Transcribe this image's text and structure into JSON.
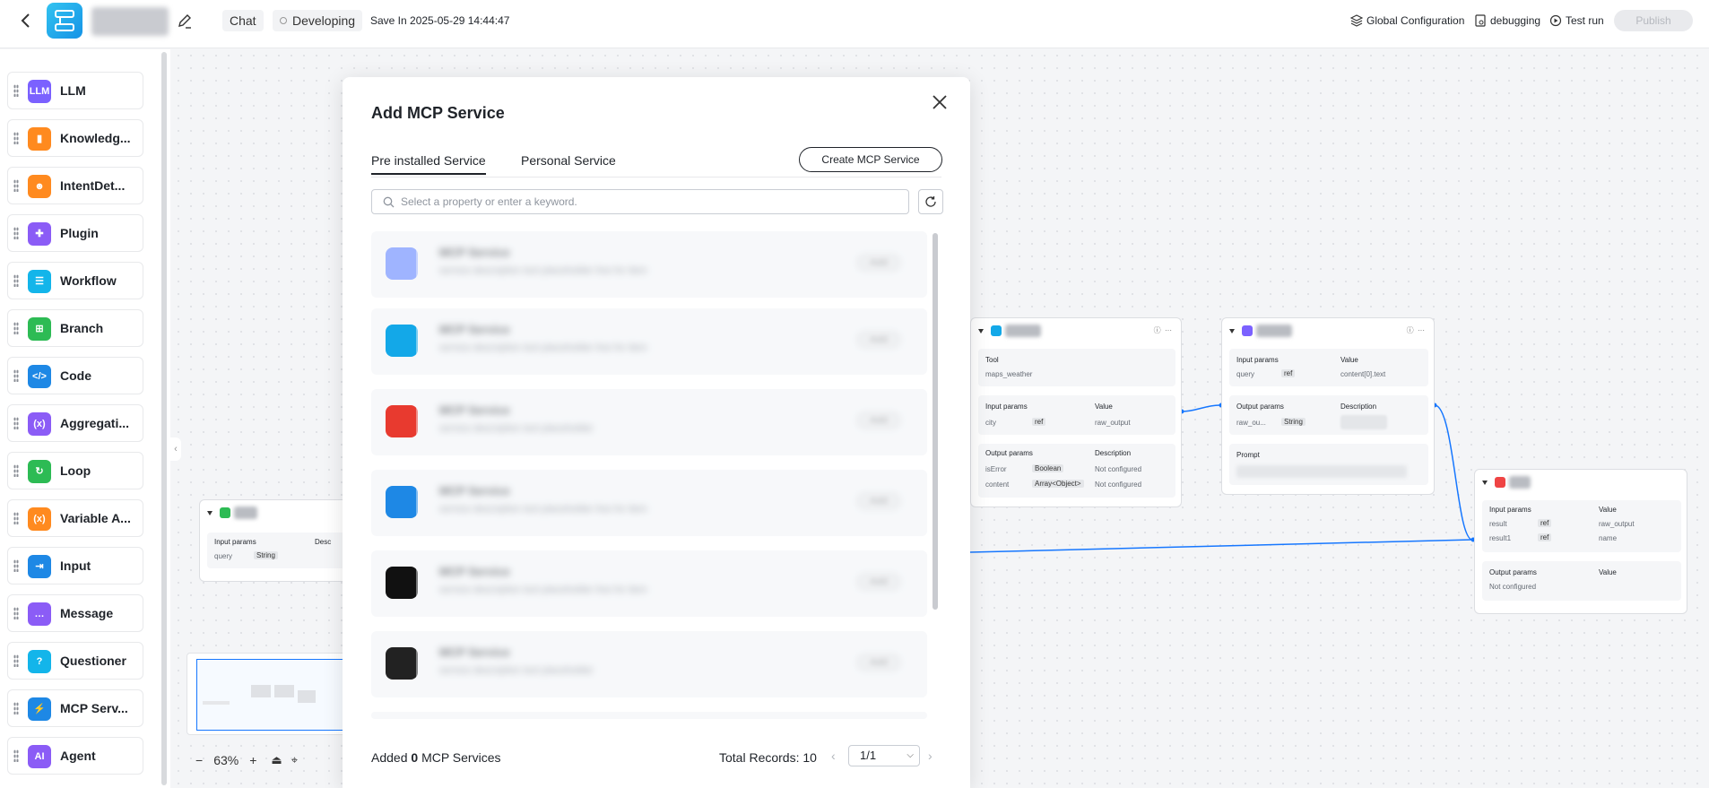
{
  "header": {
    "chat_label": "Chat",
    "status_label": "Developing",
    "save_text": "Save In 2025-05-29 14:44:47",
    "global_config_label": "Global Configuration",
    "debugging_label": "debugging",
    "test_run_label": "Test run",
    "publish_label": "Publish"
  },
  "sidebar": {
    "items": [
      {
        "label": "LLM",
        "icon": "llm-icon",
        "icon_text": "LLM",
        "color": "#7b61ff"
      },
      {
        "label": "Knowledg...",
        "icon": "book-icon",
        "icon_text": "▮",
        "color": "#ff8a1f"
      },
      {
        "label": "IntentDet...",
        "icon": "intent-icon",
        "icon_text": "☻",
        "color": "#ff8a1f"
      },
      {
        "label": "Plugin",
        "icon": "puzzle-icon",
        "icon_text": "✚",
        "color": "#8b5cf6"
      },
      {
        "label": "Workflow",
        "icon": "workflow-icon",
        "icon_text": "☰",
        "color": "#13b5ea"
      },
      {
        "label": "Branch",
        "icon": "branch-icon",
        "icon_text": "⊞",
        "color": "#2dbb54"
      },
      {
        "label": "Code",
        "icon": "code-icon",
        "icon_text": "</>",
        "color": "#1e88e5"
      },
      {
        "label": "Aggregati...",
        "icon": "aggregation-icon",
        "icon_text": "(x)",
        "color": "#8b5cf6"
      },
      {
        "label": "Loop",
        "icon": "loop-icon",
        "icon_text": "↻",
        "color": "#2dbb54"
      },
      {
        "label": "Variable A...",
        "icon": "variable-icon",
        "icon_text": "(x)",
        "color": "#ff8a1f"
      },
      {
        "label": "Input",
        "icon": "input-icon",
        "icon_text": "⇥",
        "color": "#1e88e5"
      },
      {
        "label": "Message",
        "icon": "message-icon",
        "icon_text": "…",
        "color": "#8b5cf6"
      },
      {
        "label": "Questioner",
        "icon": "question-icon",
        "icon_text": "?",
        "color": "#13b5ea"
      },
      {
        "label": "MCP Serv...",
        "icon": "mcp-icon",
        "icon_text": "⚡",
        "color": "#1e88e5"
      },
      {
        "label": "Agent",
        "icon": "agent-icon",
        "icon_text": "AI",
        "color": "#8b5cf6"
      }
    ]
  },
  "canvas": {
    "zoom": "63%",
    "start_node": {
      "input_params_label": "Input params",
      "desc_label": "Desc",
      "param": "query",
      "type": "String"
    },
    "tool_node": {
      "tool_label": "Tool",
      "tool_value": "maps_weather",
      "input_params_label": "Input params",
      "value_label": "Value",
      "input_name": "city",
      "input_ref": "ref",
      "input_value": "raw_output",
      "output_params_label": "Output params",
      "description_label": "Description",
      "outputs": [
        {
          "name": "isError",
          "type": "Boolean",
          "desc": "Not configured"
        },
        {
          "name": "content",
          "type": "Array<Object>",
          "desc": "Not configured"
        }
      ]
    },
    "llm_node": {
      "input_params_label": "Input params",
      "value_label": "Value",
      "input_name": "query",
      "input_ref": "ref",
      "input_value": "content[0].text",
      "output_params_label": "Output params",
      "description_label": "Description",
      "output_name": "raw_ou...",
      "output_type": "String",
      "prompt_label": "Prompt"
    },
    "end_node": {
      "input_params_label": "Input params",
      "value_label": "Value",
      "inputs": [
        {
          "name": "result",
          "ref": "ref",
          "value": "raw_output"
        },
        {
          "name": "result1",
          "ref": "ref",
          "value": "name"
        }
      ],
      "output_params_label": "Output params",
      "output_value_label": "Value",
      "output_state": "Not configured"
    }
  },
  "modal": {
    "title": "Add MCP Service",
    "tabs": [
      "Pre installed Service",
      "Personal Service"
    ],
    "create_label": "Create MCP Service",
    "search_placeholder": "Select a property or enter a keyword.",
    "services": [
      {
        "logo": "cluster-logo",
        "color": "#9fb4ff",
        "name": "MCP Service",
        "desc": "service description text placeholder line for item",
        "btn": "Add"
      },
      {
        "logo": "hexagon-logo",
        "color": "#13a8e8",
        "name": "MCP Service",
        "desc": "service description text placeholder line for item",
        "btn": "Add"
      },
      {
        "logo": "railway-logo",
        "color": "#e83a2f",
        "name": "MCP Service",
        "desc": "service description text placeholder",
        "btn": "Add"
      },
      {
        "logo": "bing-logo",
        "color": "#1e88e5",
        "name": "MCP Service",
        "desc": "service description text placeholder line for item",
        "btn": "Add"
      },
      {
        "logo": "leetcode-logo",
        "color": "#111111",
        "name": "MCP Service",
        "desc": "service description text placeholder line for item",
        "btn": "Add"
      },
      {
        "logo": "swirl-logo",
        "color": "#222222",
        "name": "MCP Service",
        "desc": "service description text placeholder",
        "btn": "Add"
      }
    ],
    "added_prefix": "Added",
    "added_count": "0",
    "added_suffix": "MCP Services",
    "total_records": "Total Records: 10",
    "page": "1/1"
  }
}
